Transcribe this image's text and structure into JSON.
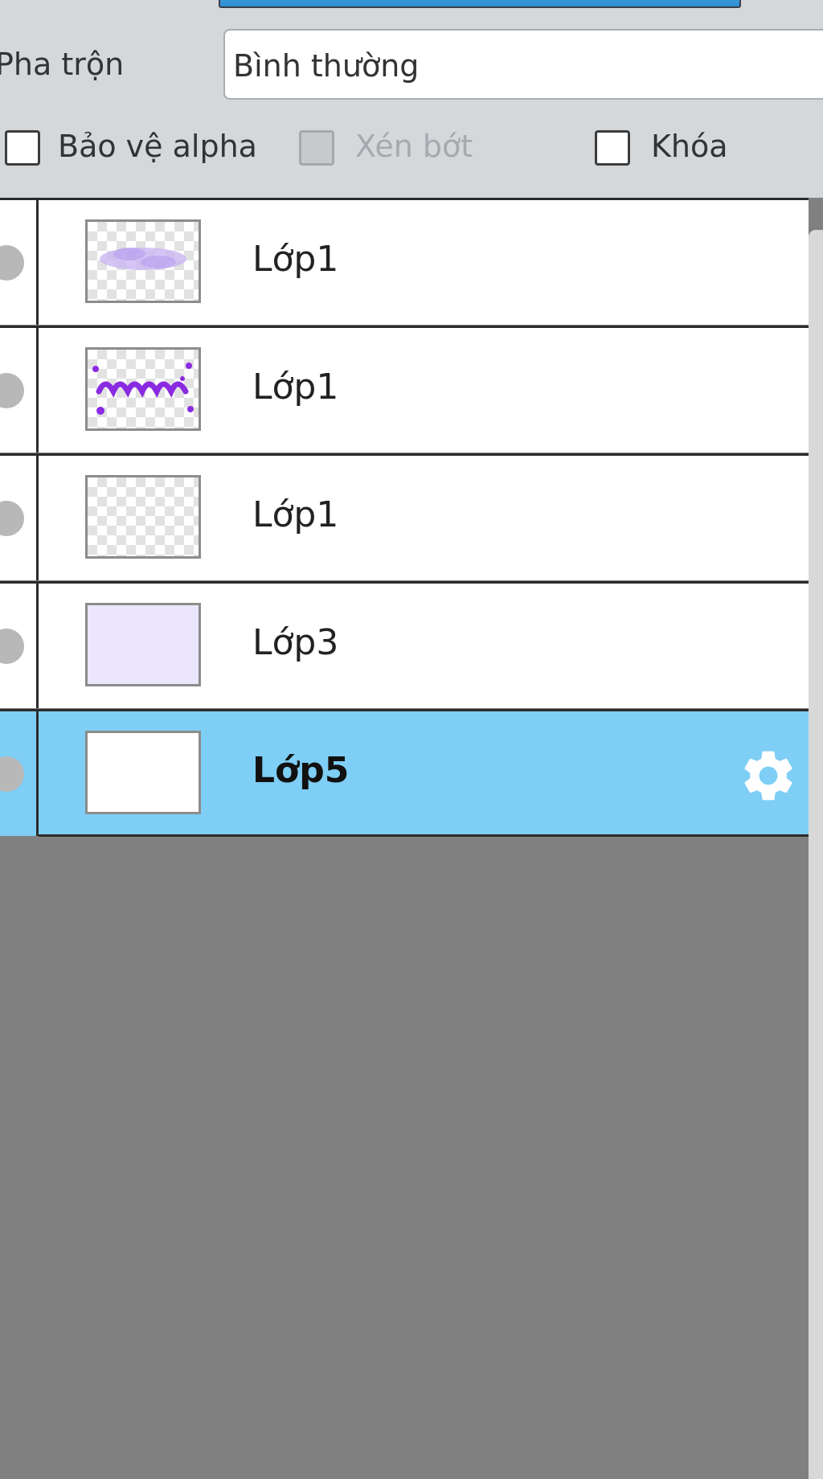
{
  "panel": {
    "opacity_label_fragment": "",
    "blend_label": "Pha trộn",
    "blend_value": "Bình thường",
    "protect_alpha_label": "Bảo vệ alpha",
    "clipping_label": "Xén bớt",
    "lock_label": "Khóa"
  },
  "layers": [
    {
      "name": "Lớp1",
      "thumb": "purple-text-faint",
      "selected": false
    },
    {
      "name": "Lớp1",
      "thumb": "purple-text",
      "selected": false
    },
    {
      "name": "Lớp1",
      "thumb": "transparent",
      "selected": false
    },
    {
      "name": "Lớp3",
      "thumb": "lavender-fill",
      "selected": false
    },
    {
      "name": "Lớp5",
      "thumb": "white-fill",
      "selected": true
    }
  ],
  "icons": {
    "layer_settings": "gear-icon",
    "visibility": "visibility-dot-icon"
  },
  "colors": {
    "selected_row": "#7ecef5",
    "slider_fill": "#2f8fd2",
    "canvas_bg": "#808080"
  }
}
